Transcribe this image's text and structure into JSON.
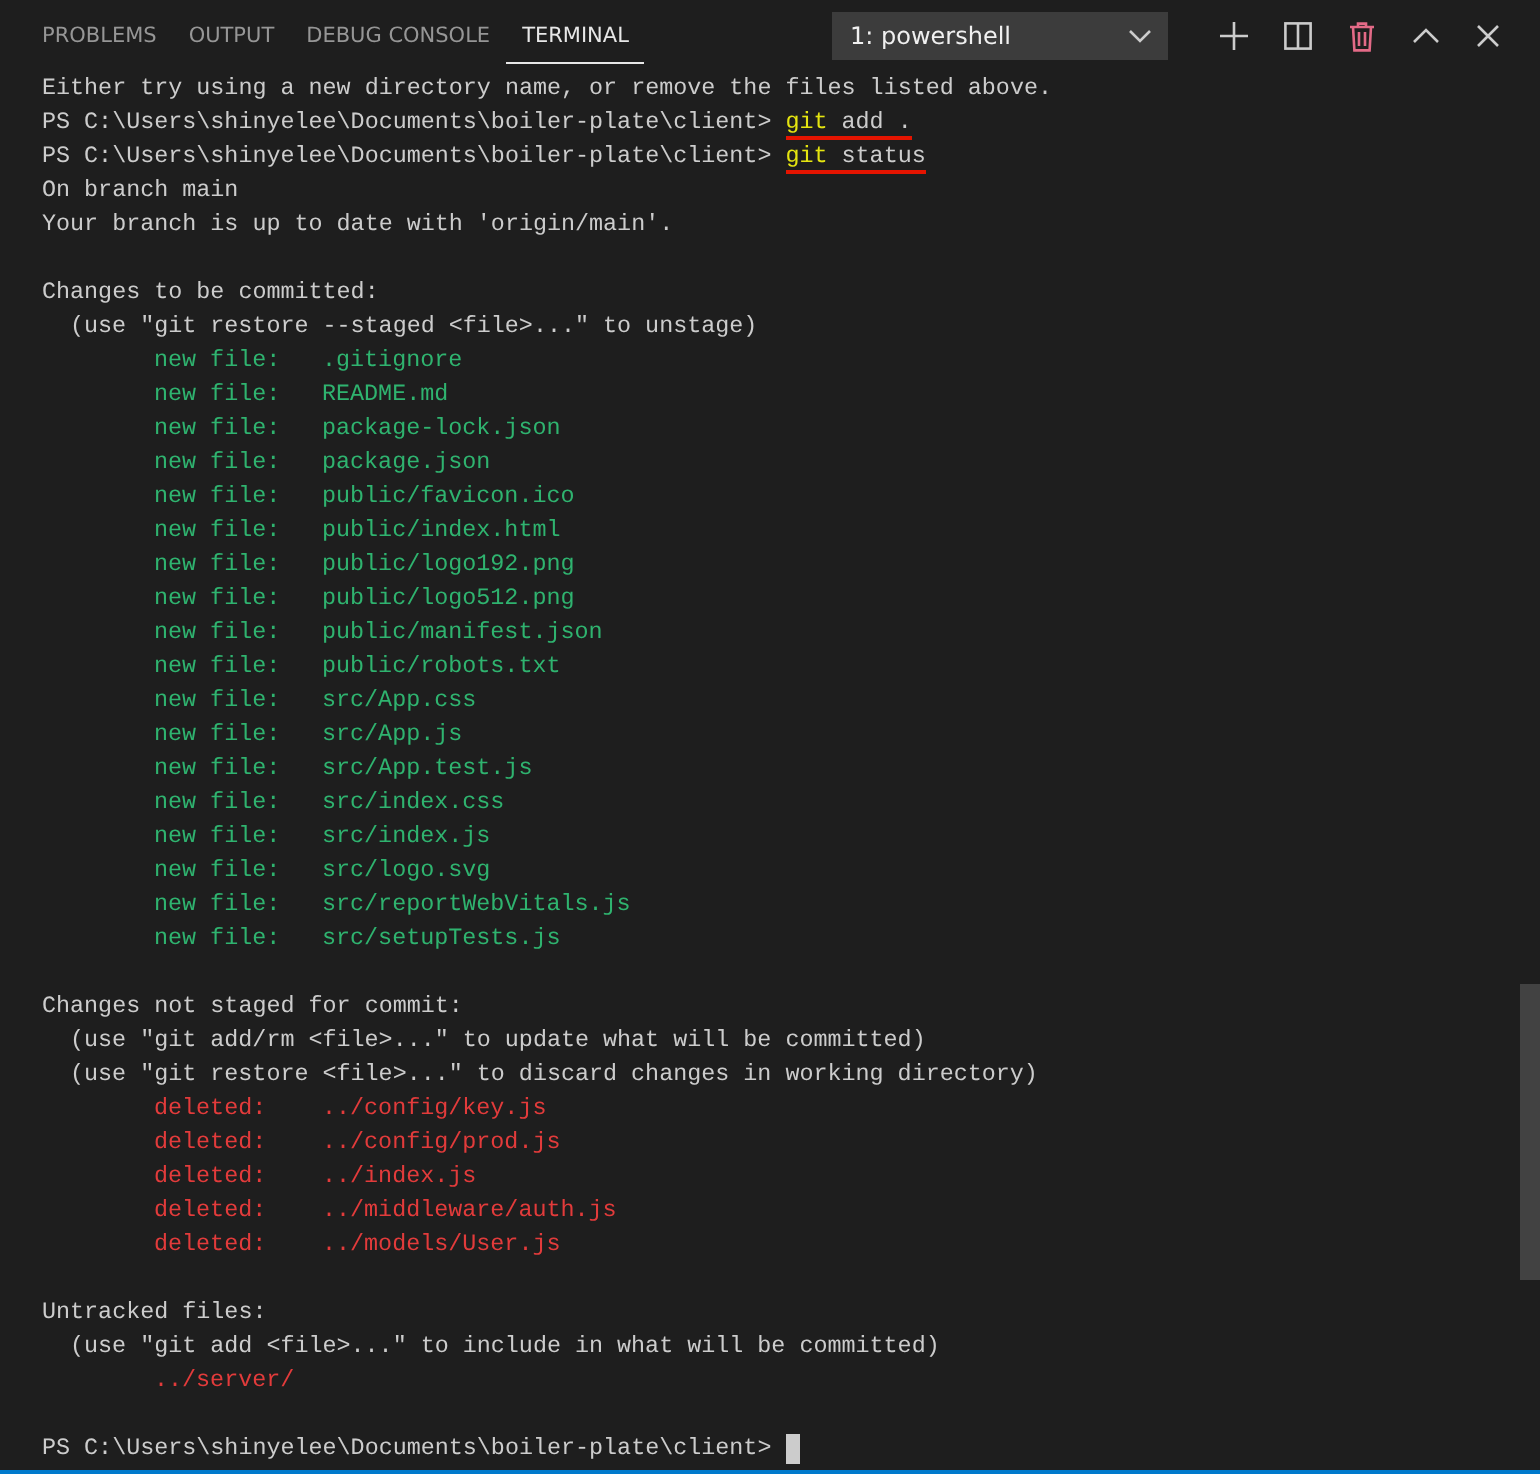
{
  "panel_tabs": [
    {
      "label": "PROBLEMS",
      "selected": false
    },
    {
      "label": "OUTPUT",
      "selected": false
    },
    {
      "label": "DEBUG CONSOLE",
      "selected": false
    },
    {
      "label": "TERMINAL",
      "selected": true
    }
  ],
  "terminal_select": {
    "value": "1: powershell"
  },
  "terminal_lines": [
    {
      "kind": "plain",
      "text": "Either try using a new directory name, or remove the files listed above."
    },
    {
      "kind": "prompt",
      "prompt": "PS C:\\Users\\shinyelee\\Documents\\boiler-plate\\client>",
      "command": "git",
      "args": "add .",
      "underlined": true,
      "cursor": false
    },
    {
      "kind": "prompt",
      "prompt": "PS C:\\Users\\shinyelee\\Documents\\boiler-plate\\client>",
      "command": "git",
      "args": "status",
      "underlined": true,
      "cursor": false
    },
    {
      "kind": "plain",
      "text": "On branch main"
    },
    {
      "kind": "plain",
      "text": "Your branch is up to date with 'origin/main'."
    },
    {
      "kind": "blank"
    },
    {
      "kind": "plain",
      "text": "Changes to be committed:"
    },
    {
      "kind": "hint",
      "text": "(use \"git restore --staged <file>...\" to unstage)"
    },
    {
      "kind": "staged",
      "label": "new file:",
      "path": ".gitignore"
    },
    {
      "kind": "staged",
      "label": "new file:",
      "path": "README.md"
    },
    {
      "kind": "staged",
      "label": "new file:",
      "path": "package-lock.json"
    },
    {
      "kind": "staged",
      "label": "new file:",
      "path": "package.json"
    },
    {
      "kind": "staged",
      "label": "new file:",
      "path": "public/favicon.ico"
    },
    {
      "kind": "staged",
      "label": "new file:",
      "path": "public/index.html"
    },
    {
      "kind": "staged",
      "label": "new file:",
      "path": "public/logo192.png"
    },
    {
      "kind": "staged",
      "label": "new file:",
      "path": "public/logo512.png"
    },
    {
      "kind": "staged",
      "label": "new file:",
      "path": "public/manifest.json"
    },
    {
      "kind": "staged",
      "label": "new file:",
      "path": "public/robots.txt"
    },
    {
      "kind": "staged",
      "label": "new file:",
      "path": "src/App.css"
    },
    {
      "kind": "staged",
      "label": "new file:",
      "path": "src/App.js"
    },
    {
      "kind": "staged",
      "label": "new file:",
      "path": "src/App.test.js"
    },
    {
      "kind": "staged",
      "label": "new file:",
      "path": "src/index.css"
    },
    {
      "kind": "staged",
      "label": "new file:",
      "path": "src/index.js"
    },
    {
      "kind": "staged",
      "label": "new file:",
      "path": "src/logo.svg"
    },
    {
      "kind": "staged",
      "label": "new file:",
      "path": "src/reportWebVitals.js"
    },
    {
      "kind": "staged",
      "label": "new file:",
      "path": "src/setupTests.js"
    },
    {
      "kind": "blank"
    },
    {
      "kind": "plain",
      "text": "Changes not staged for commit:"
    },
    {
      "kind": "hint",
      "text": "(use \"git add/rm <file>...\" to update what will be committed)"
    },
    {
      "kind": "hint",
      "text": "(use \"git restore <file>...\" to discard changes in working directory)"
    },
    {
      "kind": "deleted",
      "label": "deleted:",
      "path": "../config/key.js"
    },
    {
      "kind": "deleted",
      "label": "deleted:",
      "path": "../config/prod.js"
    },
    {
      "kind": "deleted",
      "label": "deleted:",
      "path": "../index.js"
    },
    {
      "kind": "deleted",
      "label": "deleted:",
      "path": "../middleware/auth.js"
    },
    {
      "kind": "deleted",
      "label": "deleted:",
      "path": "../models/User.js"
    },
    {
      "kind": "blank"
    },
    {
      "kind": "plain",
      "text": "Untracked files:"
    },
    {
      "kind": "hint",
      "text": "(use \"git add <file>...\" to include in what will be committed)"
    },
    {
      "kind": "untracked",
      "path": "../server/"
    },
    {
      "kind": "blank"
    },
    {
      "kind": "prompt",
      "prompt": "PS C:\\Users\\shinyelee\\Documents\\boiler-plate\\client>",
      "cursor": true
    }
  ]
}
